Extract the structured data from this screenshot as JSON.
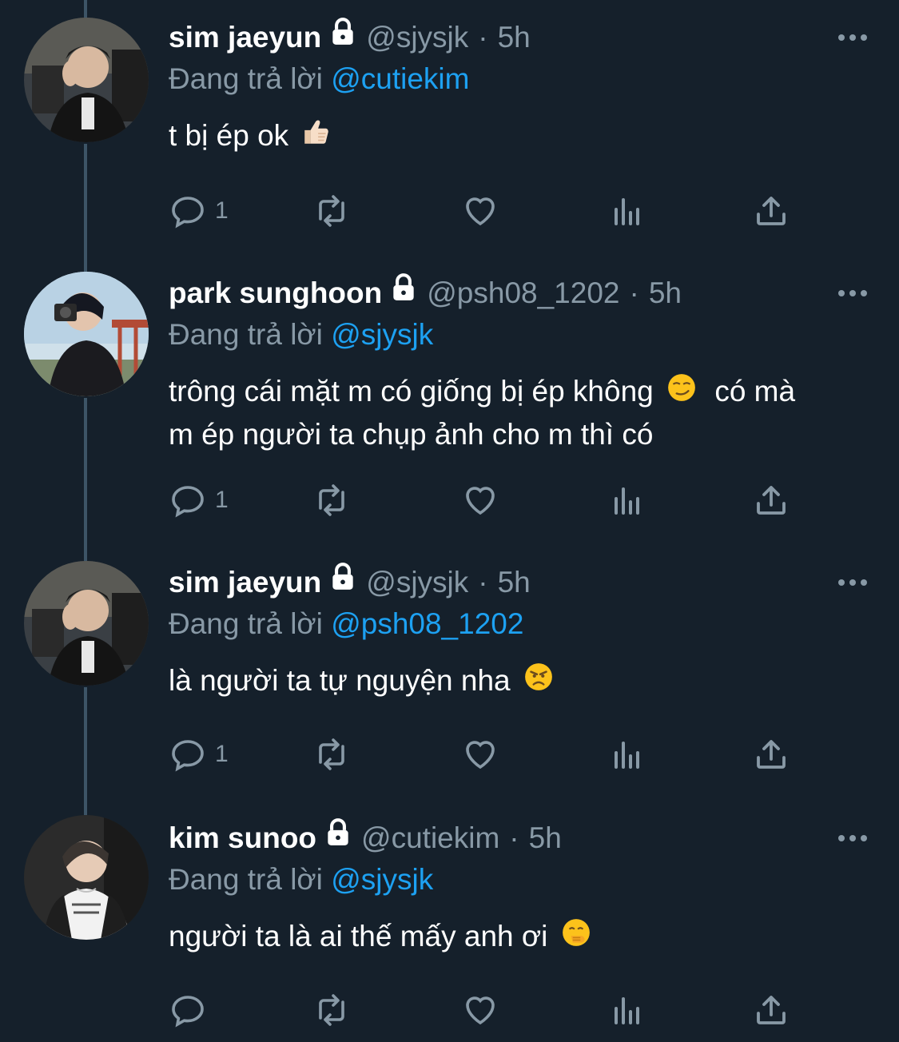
{
  "replying_prefix": "Đang trả lời",
  "tweets": [
    {
      "name": "sim jaeyun",
      "handle": "@sjysjk",
      "separator": "·",
      "time": "5h",
      "reply_to": "@cutiekim",
      "text": "t bị ép ok",
      "emoji": "thumbs-up",
      "reply_count": "1",
      "avatar_icon": "avatar-sim-jaeyun"
    },
    {
      "name": "park sunghoon",
      "handle": "@psh08_1202",
      "separator": "·",
      "time": "5h",
      "reply_to": "@sjysjk",
      "text_line1": "trông cái mặt m có giống bị ép không",
      "text_line1_after": "có mà",
      "text_line2": "m ép người ta chụp ảnh cho m thì có",
      "emoji": "smirking-face",
      "reply_count": "1",
      "avatar_icon": "avatar-park-sunghoon"
    },
    {
      "name": "sim jaeyun",
      "handle": "@sjysjk",
      "separator": "·",
      "time": "5h",
      "reply_to": "@psh08_1202",
      "text": "là người ta tự nguyện nha",
      "emoji": "angry-face",
      "reply_count": "1",
      "avatar_icon": "avatar-sim-jaeyun"
    },
    {
      "name": "kim sunoo",
      "handle": "@cutiekim",
      "separator": "·",
      "time": "5h",
      "reply_to": "@sjysjk",
      "text": "người ta là ai thế mấy anh ơi",
      "emoji": "face-with-hand-over-mouth",
      "reply_count": "",
      "avatar_icon": "avatar-kim-sunoo"
    }
  ],
  "colors": {
    "background": "#15202b",
    "text_primary": "#ffffff",
    "text_secondary": "#8899a6",
    "link": "#1da1f2",
    "thread_line": "#3d5466"
  },
  "icons": {
    "lock": "lock-icon",
    "more": "more-icon",
    "reply": "reply-icon",
    "retweet": "retweet-icon",
    "like": "like-icon",
    "views": "views-icon",
    "share": "share-icon"
  }
}
